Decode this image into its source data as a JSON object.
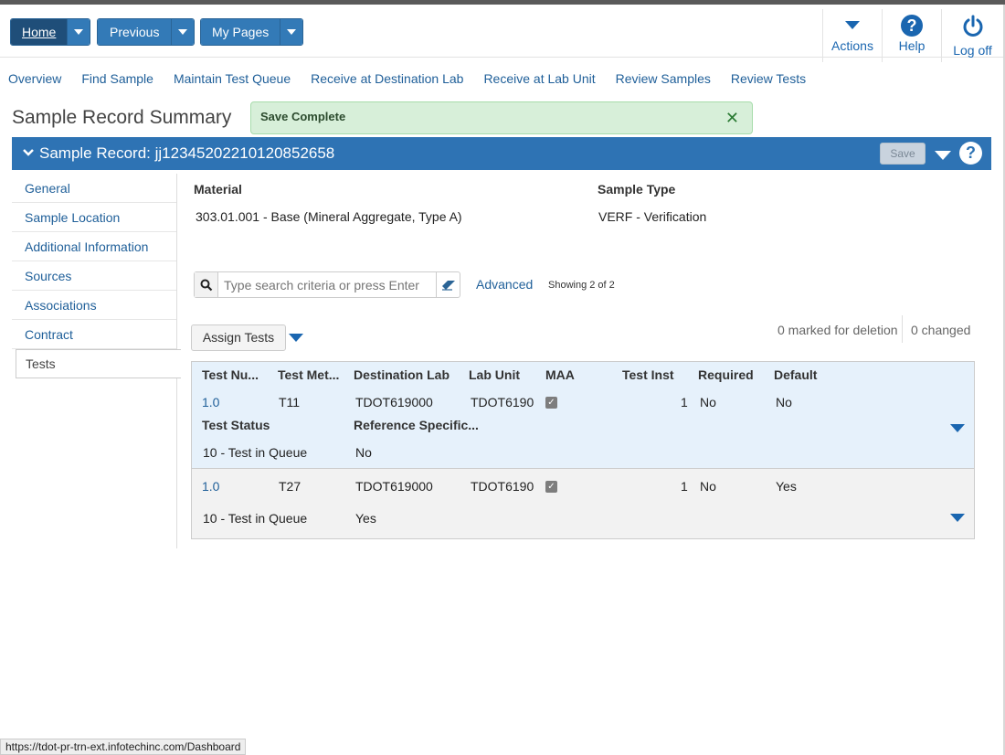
{
  "topbar": {
    "home_label": "Home",
    "previous_label": "Previous",
    "mypages_label": "My Pages",
    "actions_label": "Actions",
    "help_label": "Help",
    "logoff_label": "Log off"
  },
  "nav": {
    "items": [
      "Overview",
      "Find Sample",
      "Maintain Test Queue",
      "Receive at Destination Lab",
      "Receive at Lab Unit",
      "Review Samples",
      "Review Tests"
    ]
  },
  "page_title": "Sample Record Summary",
  "toast": {
    "message": "Save Complete",
    "close_glyph": "✕"
  },
  "record": {
    "title": "Sample Record: jj12345202210120852658",
    "save_label": "Save"
  },
  "sidebar": {
    "items": [
      "General",
      "Sample Location",
      "Additional Information",
      "Sources",
      "Associations",
      "Contract",
      "Tests"
    ],
    "active": "Tests"
  },
  "fields": {
    "material_label": "Material",
    "material_value": "303.01.001 - Base (Mineral Aggregate, Type A)",
    "sample_type_label": "Sample Type",
    "sample_type_value": "VERF - Verification"
  },
  "search": {
    "placeholder": "Type search criteria or press Enter",
    "advanced_label": "Advanced",
    "showing_text": "Showing 2 of 2"
  },
  "toolbar": {
    "assign_label": "Assign Tests",
    "marked_text": "0 marked for deletion",
    "changed_text": "0 changed"
  },
  "grid": {
    "headers": {
      "test_num": "Test Nu...",
      "test_method": "Test Met...",
      "destination_lab": "Destination Lab",
      "lab_unit": "Lab Unit",
      "maa": "MAA",
      "test_inst": "Test Inst",
      "required": "Required",
      "default": "Default",
      "test_status": "Test Status",
      "reference_spec": "Reference Specific..."
    },
    "rows": [
      {
        "test_num": "1.0",
        "test_method": "T11",
        "destination_lab": "TDOT619000",
        "lab_unit": "TDOT6190",
        "maa_checked": true,
        "test_inst": "1",
        "required": "No",
        "default": "No",
        "test_status": "10 - Test in Queue",
        "reference_spec": "No"
      },
      {
        "test_num": "1.0",
        "test_method": "T27",
        "destination_lab": "TDOT619000",
        "lab_unit": "TDOT6190",
        "maa_checked": true,
        "test_inst": "1",
        "required": "No",
        "default": "Yes",
        "test_status": "10 - Test in Queue",
        "reference_spec": "Yes"
      }
    ]
  },
  "status_bar": {
    "url": "https://tdot-pr-trn-ext.infotechinc.com/Dashboard"
  },
  "colors": {
    "primary": "#337ab7",
    "record_bar": "#2e73b4",
    "link": "#1f5f99",
    "toast_bg": "#d7efd9",
    "row_selected": "#e6f1fb"
  }
}
